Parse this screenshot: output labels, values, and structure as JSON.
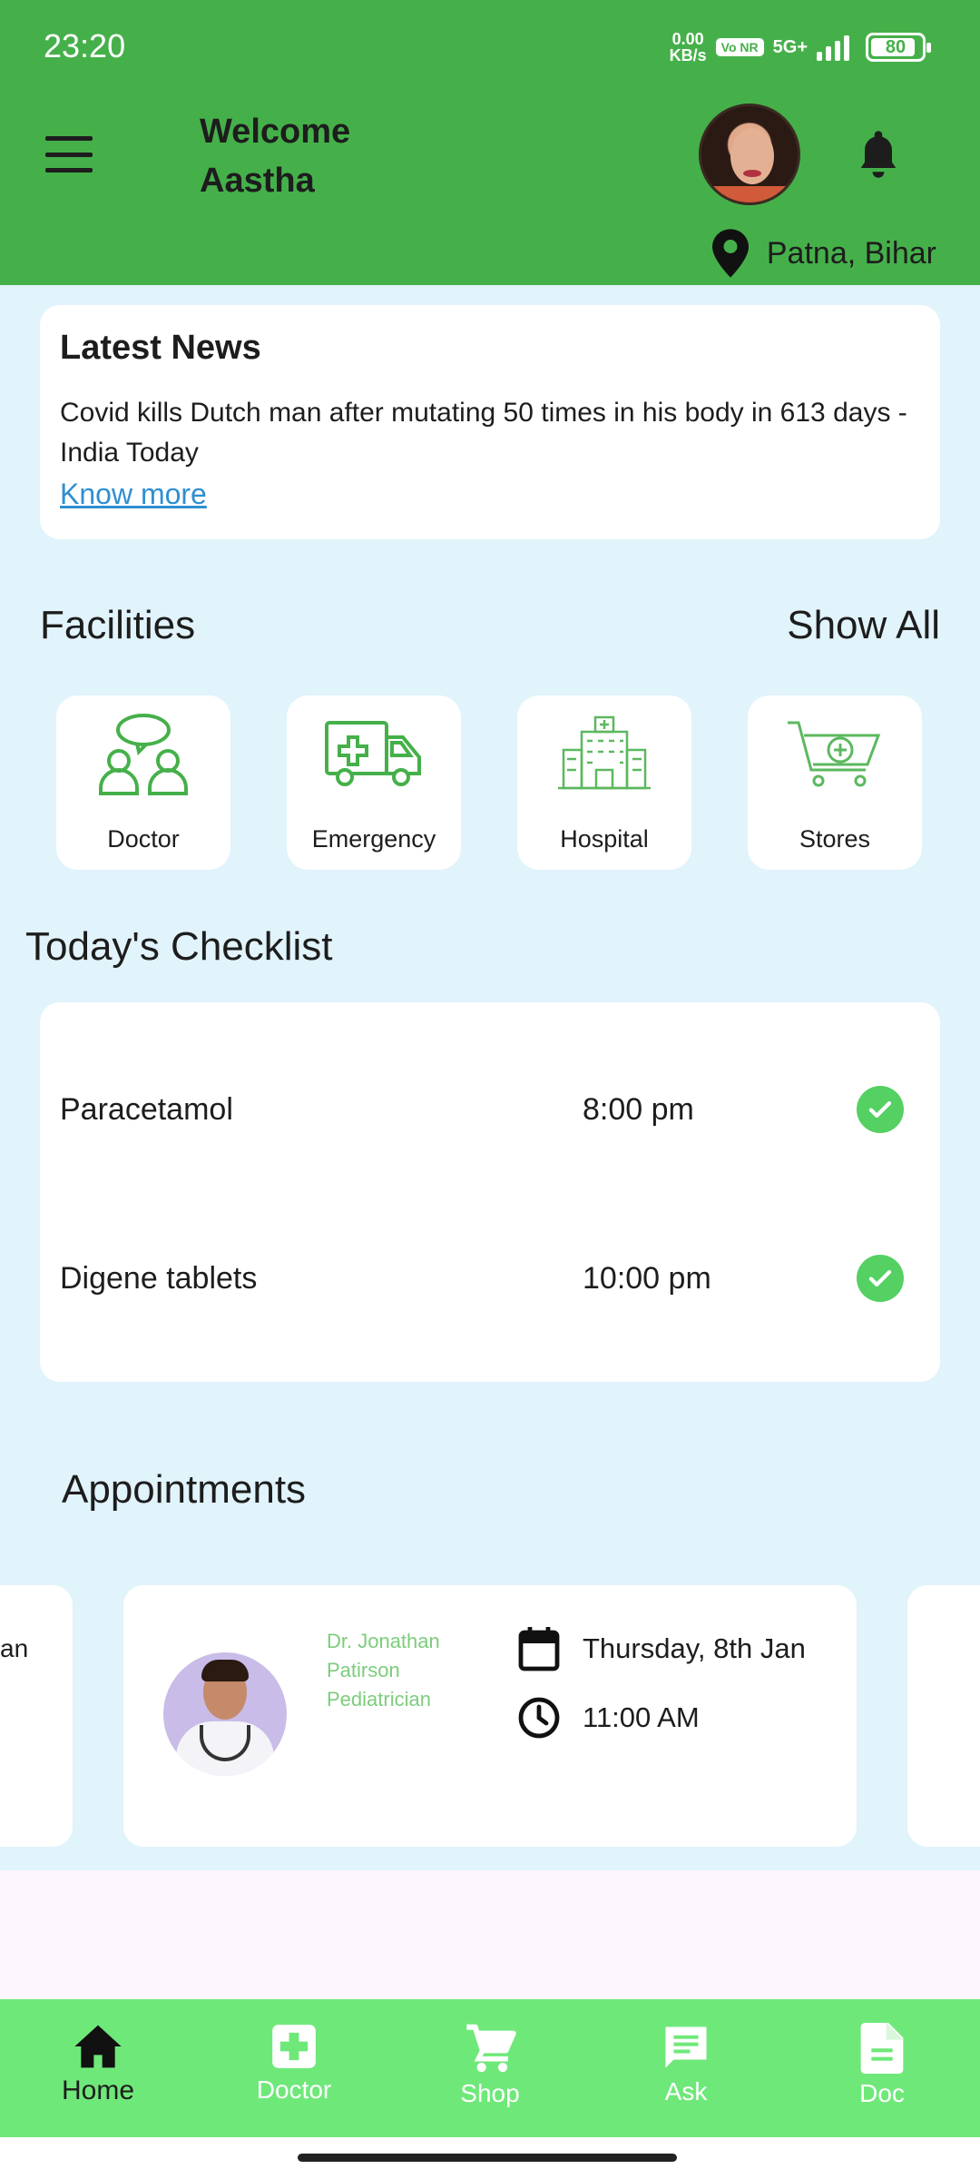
{
  "status": {
    "time": "23:20",
    "net_speed": "0.00",
    "net_unit": "KB/s",
    "volte": "Vo NR",
    "network": "5G+",
    "battery": "80"
  },
  "header": {
    "welcome": "Welcome\nAastha",
    "location": "Patna, Bihar"
  },
  "news": {
    "title": "Latest News",
    "headline": "Covid kills Dutch man after mutating 50 times in his body in 613 days - India Today",
    "link": "Know more"
  },
  "facilities": {
    "title": "Facilities",
    "show_all": "Show All",
    "items": [
      {
        "label": "Doctor",
        "icon": "doctor-consult-icon"
      },
      {
        "label": "Emergency",
        "icon": "ambulance-icon"
      },
      {
        "label": "Hospital",
        "icon": "hospital-building-icon"
      },
      {
        "label": "Stores",
        "icon": "medical-cart-icon"
      }
    ]
  },
  "checklist": {
    "title": "Today's Checklist",
    "items": [
      {
        "name": "Paracetamol",
        "time": "8:00 pm",
        "done": true
      },
      {
        "name": "Digene tablets",
        "time": "10:00 pm",
        "done": true
      }
    ]
  },
  "appointments": {
    "title": "Appointments",
    "prev_fragment": "an",
    "current": {
      "doctor_line1": "Dr. Jonathan",
      "doctor_line2": "Patirson",
      "specialty": "Pediatrician",
      "date": "Thursday, 8th Jan",
      "time": "11:00 AM"
    }
  },
  "nav": {
    "items": [
      {
        "label": "Home",
        "icon": "home-icon"
      },
      {
        "label": "Doctor",
        "icon": "medical-cross-icon"
      },
      {
        "label": "Shop",
        "icon": "cart-icon"
      },
      {
        "label": "Ask",
        "icon": "chat-icon"
      },
      {
        "label": "Doc",
        "icon": "document-icon"
      }
    ]
  },
  "colors": {
    "header": "#45b04a",
    "background": "#e1f3fb",
    "nav": "#6fe87a",
    "check": "#55d062",
    "link": "#2f8fd0",
    "doctor_text": "#7ccd7c"
  }
}
